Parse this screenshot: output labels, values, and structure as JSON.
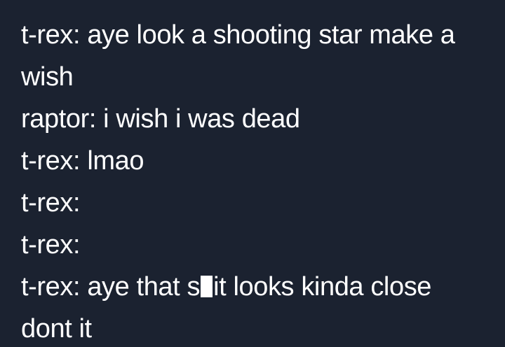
{
  "tweet": {
    "lines": [
      "t-rex: aye look a shooting star make a",
      "wish",
      "raptor: i wish i was dead",
      "t-rex: lmao",
      "t-rex:",
      "t-rex:"
    ],
    "censored_line": {
      "before": "t-rex: aye that s",
      "after": "it looks kinda close"
    },
    "final_line": "dont it"
  }
}
